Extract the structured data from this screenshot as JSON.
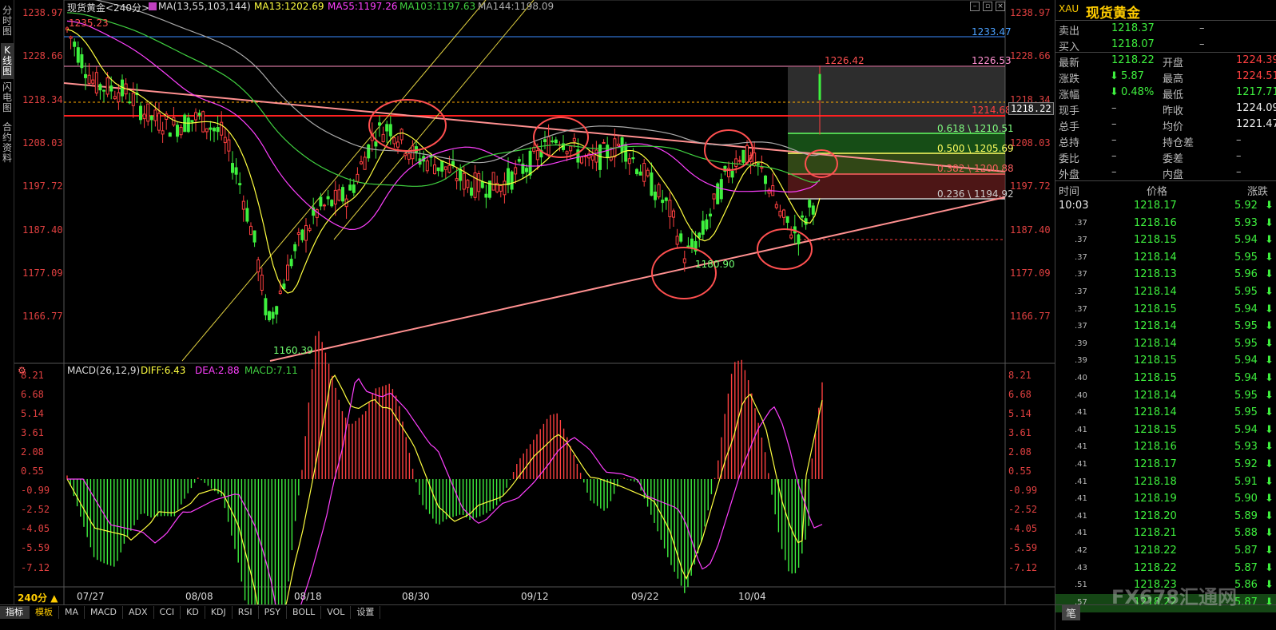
{
  "left_tabs": [
    "分时图",
    "K线图",
    "闪电图",
    "合约资料"
  ],
  "header": {
    "instrument": "现货黄金<240分>",
    "ma_label": "MA(13,55,103,144)",
    "ma13": "MA13:1202.69",
    "ma55": "MA55:1197.26",
    "ma103": "MA103:1197.63",
    "ma144": "MA144:1198.09"
  },
  "price_axis_left": [
    "1238.97",
    "1228.66",
    "1218.34",
    "1208.03",
    "1197.72",
    "1187.40",
    "1177.09",
    "1166.77"
  ],
  "price_axis_right": [
    "1238.97",
    "1228.66",
    "1218.34",
    "1208.03",
    "1197.72",
    "1187.40",
    "1177.09",
    "1166.77"
  ],
  "annotations": {
    "high_label": "1235.23",
    "low_label": "1160.39",
    "low2_label": "1180.90",
    "peak_label": "1226.42",
    "blue_line_label": "1233.47",
    "pink_line_label": "1226.53",
    "red_line_label": "1214.68",
    "current_price_box": "1218.22",
    "fib_618": "0.618 \\ 1210.51",
    "fib_500": "0.500 \\ 1205.69",
    "fib_382": "0.382 \\ 1200.88",
    "fib_236": "0.236 \\ 1194.92"
  },
  "macd": {
    "label": "MACD(26,12,9)",
    "diff": "DIFF:6.43",
    "dea": "DEA:2.88",
    "macd": "MACD:7.11",
    "axis": [
      "8.21",
      "6.68",
      "5.14",
      "3.61",
      "2.08",
      "0.55",
      "-0.99",
      "-2.52",
      "-4.05",
      "-5.59",
      "-7.12"
    ]
  },
  "date_axis": {
    "period": "240分",
    "dates": [
      "07/27",
      "08/08",
      "08/18",
      "08/30",
      "09/12",
      "09/22",
      "10/04"
    ]
  },
  "bottom_tabs": [
    "指标",
    "模板",
    "MA",
    "MACD",
    "ADX",
    "CCI",
    "KD",
    "KDJ",
    "RSI",
    "PSY",
    "BOLL",
    "VOL",
    "设置"
  ],
  "quote_panel": {
    "code": "XAU",
    "name": "现货黄金",
    "sell_label": "卖出",
    "sell_value": "1218.37",
    "sell_vol": "–",
    "buy_label": "买入",
    "buy_value": "1218.07",
    "buy_vol": "–",
    "rows": [
      {
        "l1": "最新",
        "v1": "1218.22",
        "l2": "开盘",
        "v2": "1224.39"
      },
      {
        "l1": "涨跌",
        "v1": "5.87",
        "l2": "最高",
        "v2": "1224.51"
      },
      {
        "l1": "涨幅",
        "v1": "0.48%",
        "l2": "最低",
        "v2": "1217.71"
      },
      {
        "l1": "现手",
        "v1": "–",
        "l2": "昨收",
        "v2": "1224.09"
      },
      {
        "l1": "总手",
        "v1": "–",
        "l2": "均价",
        "v2": "1221.47"
      },
      {
        "l1": "总持",
        "v1": "–",
        "l2": "持仓差",
        "v2": "–"
      },
      {
        "l1": "委比",
        "v1": "–",
        "l2": "委差",
        "v2": "–"
      },
      {
        "l1": "外盘",
        "v1": "–",
        "l2": "内盘",
        "v2": "–"
      }
    ],
    "tick_headers": [
      "时间",
      "价格",
      "涨跌"
    ],
    "ticks": [
      {
        "t": "10:03",
        "p": "1218.17",
        "c": "5.92"
      },
      {
        "t": ".37",
        "p": "1218.16",
        "c": "5.93"
      },
      {
        "t": ".37",
        "p": "1218.15",
        "c": "5.94"
      },
      {
        "t": ".37",
        "p": "1218.14",
        "c": "5.95"
      },
      {
        "t": ".37",
        "p": "1218.13",
        "c": "5.96"
      },
      {
        "t": ".37",
        "p": "1218.14",
        "c": "5.95"
      },
      {
        "t": ".37",
        "p": "1218.15",
        "c": "5.94"
      },
      {
        "t": ".37",
        "p": "1218.14",
        "c": "5.95"
      },
      {
        "t": ".39",
        "p": "1218.14",
        "c": "5.95"
      },
      {
        "t": ".39",
        "p": "1218.15",
        "c": "5.94"
      },
      {
        "t": ".40",
        "p": "1218.15",
        "c": "5.94"
      },
      {
        "t": ".40",
        "p": "1218.14",
        "c": "5.95"
      },
      {
        "t": ".41",
        "p": "1218.14",
        "c": "5.95"
      },
      {
        "t": ".41",
        "p": "1218.15",
        "c": "5.94"
      },
      {
        "t": ".41",
        "p": "1218.16",
        "c": "5.93"
      },
      {
        "t": ".41",
        "p": "1218.17",
        "c": "5.92"
      },
      {
        "t": ".41",
        "p": "1218.18",
        "c": "5.91"
      },
      {
        "t": ".41",
        "p": "1218.19",
        "c": "5.90"
      },
      {
        "t": ".41",
        "p": "1218.20",
        "c": "5.89"
      },
      {
        "t": ".41",
        "p": "1218.21",
        "c": "5.88"
      },
      {
        "t": ".42",
        "p": "1218.22",
        "c": "5.87"
      },
      {
        "t": ".43",
        "p": "1218.22",
        "c": "5.87"
      },
      {
        "t": ".51",
        "p": "1218.23",
        "c": "5.86"
      },
      {
        "t": ".57",
        "p": "1218.22",
        "c": "5.87"
      }
    ],
    "footer": "笔",
    "watermark": "FX678汇通网"
  },
  "colors": {
    "up": "#ff4040",
    "down": "#3ef03e",
    "ma13": "#ffff40",
    "ma55": "#ff40ff",
    "ma103": "#40d040",
    "ma144": "#aaaaaa"
  }
}
